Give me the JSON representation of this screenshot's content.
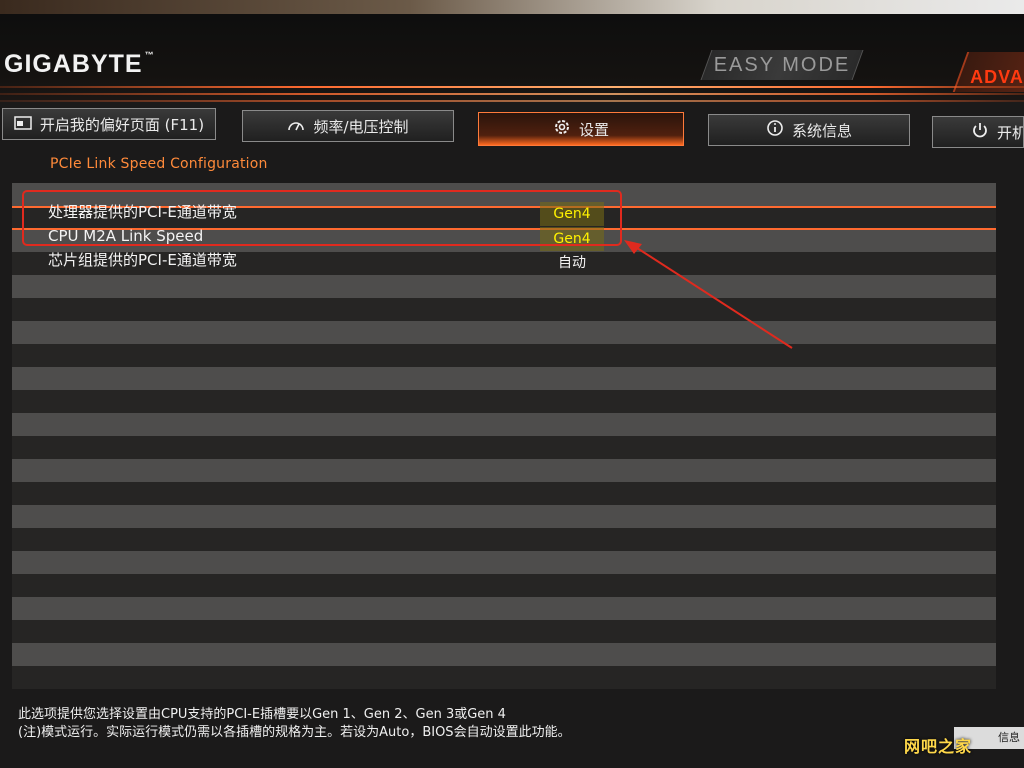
{
  "brand": {
    "logo": "GIGABYTE",
    "tm": "™"
  },
  "header": {
    "easy_mode": "EASY MODE",
    "advanced_tab": "ADVAN"
  },
  "nav": {
    "favorites": {
      "label": "开启我的偏好页面 (F11)",
      "icon": "favorite-page-icon"
    },
    "freq": {
      "label": "频率/电压控制",
      "icon": "gauge-icon"
    },
    "settings": {
      "label": "设置",
      "icon": "gear-icon"
    },
    "sysinfo": {
      "label": "系统信息",
      "icon": "info-icon"
    },
    "boot": {
      "label": "开机",
      "icon": "power-icon"
    }
  },
  "breadcrumb": "PCIe Link Speed Configuration",
  "items": [
    {
      "label": "处理器提供的PCI-E通道带宽",
      "value": "Gen4"
    },
    {
      "label": "CPU M2A Link Speed",
      "value": "Gen4"
    },
    {
      "label": "芯片组提供的PCI-E通道带宽",
      "value": "自动"
    }
  ],
  "help": {
    "line1": "此选项提供您选择设置由CPU支持的PCI-E插槽要以Gen 1、Gen 2、Gen 3或Gen 4",
    "line2": "(注)模式运行。实际运行模式仍需以各插槽的规格为主。若设为Auto，BIOS会自动设置此功能。"
  },
  "footer": {
    "info_button": "信息"
  },
  "watermark": "网吧之家",
  "colors": {
    "accent": "#ff6a30",
    "highlight_value": "#fff200",
    "annotation": "#e02a1e"
  }
}
